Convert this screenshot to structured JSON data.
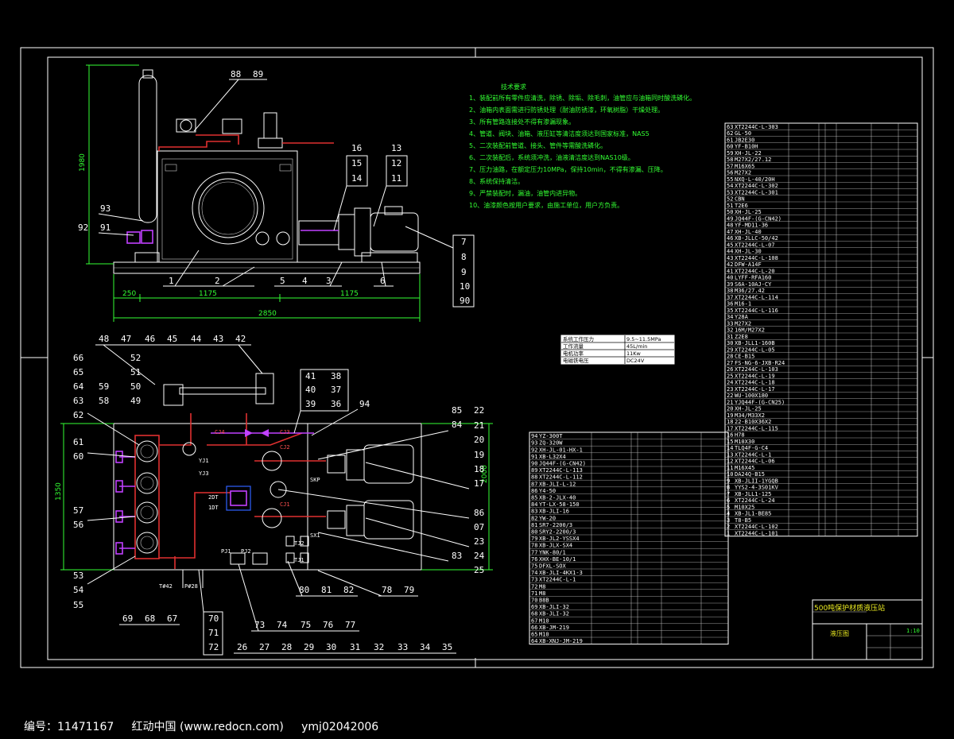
{
  "colors": {
    "background": "#000000",
    "lines": "#ffffff",
    "dimensions": "#33ff33",
    "pipes": "#e03030",
    "valves": "#c040ff",
    "notes": "#33ff33"
  },
  "top_view": {
    "balloons_top": [
      "88",
      "89"
    ],
    "balloons_right": [
      "16",
      "15",
      "14",
      "13",
      "12",
      "11"
    ],
    "balloons_left": [
      "93",
      "92",
      "91"
    ],
    "balloons_side": [
      "7",
      "8",
      "9",
      "10",
      "90"
    ],
    "balloons_bottom": [
      "1",
      "2",
      "5",
      "4",
      "3",
      "6"
    ],
    "dims": {
      "height": "1980",
      "seg1": "250",
      "seg2": "1175",
      "seg3": "1175",
      "total": "2850"
    }
  },
  "notes": {
    "title": "技术要求",
    "items": [
      "1、装配前所有零件应清洗，除锈、除垢、除毛刺，油管应与油箱同时酸洗磷化。",
      "2、油箱内表面需进行防锈处理（耐油防锈漆，环氧树脂）干燥处理。",
      "3、所有管路连接处不得有渗漏现象。",
      "4、管道、阀块、油箱、液压缸等清洁度须达到国家标准，NAS5",
      "5、二次装配前管道、接头、管件等需酸洗磷化。",
      "6、二次装配后，系统须冲洗，油液清洁度达到NAS10级。",
      "7、压力油路，在额定压力10MPa，保持10min，不得有渗漏、压降。",
      "8、系统保持清洁。",
      "9、严禁装配时，漏油，油管内进异物。",
      "10、油漆颜色按用户要求，由施工单位，用户方负责。"
    ]
  },
  "spec_table": [
    [
      "系统工作压力",
      "9.5~11.5MPa"
    ],
    [
      "工作流量",
      "45L/min"
    ],
    [
      "电机功率",
      "11Kw"
    ],
    [
      "电磁铁电压",
      "DC24V"
    ]
  ],
  "plan_view": {
    "balloons_top": [
      "48",
      "47",
      "46",
      "45",
      "44",
      "43",
      "42"
    ],
    "balloons_top_mid": [
      "52",
      "51",
      "50",
      "49",
      "41",
      "40",
      "39",
      "38",
      "37",
      "36",
      "94"
    ],
    "balloons_left": [
      "66",
      "65",
      "64",
      "63",
      "62",
      "59",
      "58",
      "61",
      "60",
      "57",
      "56",
      "53",
      "54",
      "55"
    ],
    "balloons_right": [
      "85",
      "84",
      "22",
      "21",
      "20",
      "19",
      "18",
      "17",
      "86",
      "07",
      "23",
      "83",
      "24",
      "25"
    ],
    "balloons_bottom": [
      "69",
      "68",
      "67",
      "70",
      "71",
      "72",
      "73",
      "74",
      "75",
      "76",
      "77",
      "78",
      "79",
      "80",
      "81",
      "82"
    ],
    "balloons_bottom_row": [
      "26",
      "27",
      "28",
      "29",
      "30",
      "31",
      "32",
      "33",
      "34",
      "35"
    ],
    "labels": [
      "CJ4",
      "CJ3",
      "CJ2",
      "CJ1",
      "YJ1",
      "YJ3",
      "2DT",
      "1DT",
      "SKP",
      "SX1",
      "TJ2",
      "TJ1",
      "PJ1",
      "PJ2",
      "T#42",
      "P#28"
    ],
    "dims": {
      "width": "1350",
      "height": "2000"
    }
  },
  "bom_right": [
    [
      "63",
      "XT2244C-L-303"
    ],
    [
      "62",
      "GL-50"
    ],
    [
      "61",
      "JB2E30"
    ],
    [
      "60",
      "YF-B10H"
    ],
    [
      "59",
      "XH-JL-22"
    ],
    [
      "58",
      "M27X2/27.12"
    ],
    [
      "57",
      "M16X65"
    ],
    [
      "56",
      "M27X2"
    ],
    [
      "55",
      "NXQ-L-40/20H"
    ],
    [
      "54",
      "XT2244C-L-302"
    ],
    [
      "53",
      "XT2244C-L-301"
    ],
    [
      "52",
      "CBN"
    ],
    [
      "51",
      "T2E6"
    ],
    [
      "50",
      "XH-JL-25"
    ],
    [
      "49",
      "JQ44F-(G-CN42)"
    ],
    [
      "48",
      "YF-MD11-36"
    ],
    [
      "47",
      "XH-JL-40"
    ],
    [
      "46",
      "XB-JLLC-50/42"
    ],
    [
      "45",
      "XT2244C-L-07"
    ],
    [
      "44",
      "XH-JL-30"
    ],
    [
      "43",
      "XT2244C-L-108"
    ],
    [
      "42",
      "DFW-A14F"
    ],
    [
      "41",
      "XT2244C-L-20"
    ],
    [
      "40",
      "LYFF-RFA160"
    ],
    [
      "39",
      "S6A-10AJ-CY"
    ],
    [
      "38",
      "M36/27.42"
    ],
    [
      "37",
      "XT2244C-L-114"
    ],
    [
      "36",
      "M16-1"
    ],
    [
      "35",
      "XT2244C-L-116"
    ],
    [
      "34",
      "Y28A"
    ],
    [
      "33",
      "M27X2"
    ],
    [
      "32",
      "16M/M27X2"
    ],
    [
      "31",
      "Z2E8"
    ],
    [
      "30",
      "XB-JLL1-160B"
    ],
    [
      "29",
      "XT2244C-L-05"
    ],
    [
      "28",
      "CE-B15"
    ],
    [
      "27",
      "FS-NG-6-JXB-R24"
    ],
    [
      "26",
      "XT2244C-L-103"
    ],
    [
      "25",
      "XT2244C-L-19"
    ],
    [
      "24",
      "XT2244C-L-18"
    ],
    [
      "23",
      "XT2244C-L-17"
    ],
    [
      "22",
      "WU-100X180"
    ],
    [
      "21",
      "YJQ44F-(G-CN25)"
    ],
    [
      "20",
      "XH-JL-25"
    ],
    [
      "19",
      "M34/M33X2"
    ],
    [
      "18",
      "22-B10X36X2"
    ],
    [
      "17",
      "XT2244C-L-115"
    ],
    [
      "16",
      "H78"
    ],
    [
      "15",
      "M10X30"
    ],
    [
      "14",
      "TLQ4F-G-C4"
    ],
    [
      "13",
      "XT2244C-L-1"
    ],
    [
      "12",
      "XT2244C-L-06"
    ],
    [
      "11",
      "M16X45"
    ],
    [
      "10",
      "DA24Q-B15"
    ],
    [
      "9",
      "XB-JLII-1YGQB"
    ],
    [
      "8",
      "YYS2-4-3S01KV"
    ],
    [
      "7",
      "XB-JLL1-125"
    ],
    [
      "6",
      "XT2244C-L-24"
    ],
    [
      "5",
      "M10X25"
    ],
    [
      "4",
      "XB-JL1-BE85"
    ],
    [
      "3",
      "T8-B5"
    ],
    [
      "2",
      "XT2244C-L-102"
    ],
    [
      "1",
      "XT2244C-L-101"
    ]
  ],
  "bom_left": [
    [
      "94",
      "YZ-300T"
    ],
    [
      "93",
      "ZQ-320W"
    ],
    [
      "92",
      "XH-JL-01-HX-1"
    ],
    [
      "91",
      "XB-L32X4"
    ],
    [
      "90",
      "JQ44F-(G-CN42)"
    ],
    [
      "89",
      "XT2244C-L-113"
    ],
    [
      "88",
      "XT2244C-L-112"
    ],
    [
      "87",
      "XB-JLI-L-12"
    ],
    [
      "86",
      "Y4-50"
    ],
    [
      "85",
      "XB-2-JLX-40"
    ],
    [
      "84",
      "YT-LX-58-150"
    ],
    [
      "83",
      "XB-JLI-16"
    ],
    [
      "82",
      "YW-20"
    ],
    [
      "81",
      "SR7-2200/3"
    ],
    [
      "80",
      "SRY2-2200/3"
    ],
    [
      "79",
      "XB-JL2-YSSX4"
    ],
    [
      "78",
      "XB-JLX-SX4"
    ],
    [
      "77",
      "YNK-80/1"
    ],
    [
      "76",
      "XHX-BE-10/1"
    ],
    [
      "75",
      "DFXL-SOX"
    ],
    [
      "74",
      "XB-JLI-4KX1-3"
    ],
    [
      "73",
      "XT2244C-L-1"
    ],
    [
      "72",
      "M8"
    ],
    [
      "71",
      "M8"
    ],
    [
      "70",
      "B8B"
    ],
    [
      "69",
      "XB-JLI-32"
    ],
    [
      "68",
      "XB-JLI-32"
    ],
    [
      "67",
      "M10"
    ],
    [
      "66",
      "XB-JM-219"
    ],
    [
      "65",
      "M10"
    ],
    [
      "64",
      "XB-XNJ-JM-219"
    ]
  ],
  "title_block": {
    "name": "500吨保护材质液压站",
    "drawing": "液压图",
    "scale": "1:10"
  },
  "footer": {
    "id_label": "编号：11471167",
    "site": "红动中国 (www.redocn.com)",
    "user": "ymj02042006"
  }
}
